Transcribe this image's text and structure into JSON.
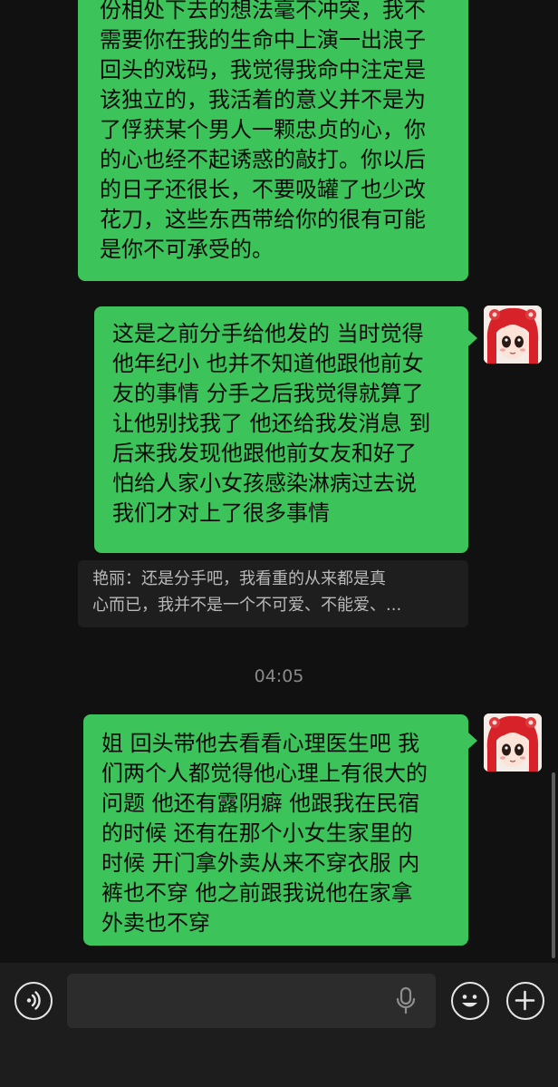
{
  "messages": [
    {
      "lines": [
        "份相处下去的想法毫不冲突，我不",
        "需要你在我的生命中上演一出浪子",
        "回头的戏码，我觉得我命中注定是",
        "该独立的，我活着的意义并不是为",
        "了俘获某个男人一颗忠贞的心，你",
        "的心也经不起诱惑的敲打。你以后",
        "的日子还很长，不要吸罐了也少改",
        "花刀，这些东西带给你的很有可能",
        "是你不可承受的。"
      ]
    },
    {
      "lines": [
        "这是之前分手给他发的 当时觉得",
        "他年纪小 也并不知道他跟他前女",
        "友的事情 分手之后我觉得就算了",
        "让他别找我了 他还给我发消息 到",
        "后来我发现他跟他前女友和好了",
        "怕给人家小女孩感染淋病过去说",
        "我们才对上了很多事情"
      ]
    },
    {
      "lines": [
        "姐 回头带他去看看心理医生吧 我",
        "们两个人都觉得他心理上有很大的",
        "问题 他还有露阴癖 他跟我在民宿",
        "的时候 还有在那个小女生家里的",
        "时候 开门拿外卖从来不穿衣服 内",
        "裤也不穿 他之前跟我说他在家拿",
        "外卖也不穿"
      ]
    }
  ],
  "quote": {
    "line1": "艳丽：还是分手吧，我看重的从来都是真",
    "line2": "心而已，我并不是一个不可爱、不能爱、..."
  },
  "timestamp": "04:05",
  "input": {
    "value": "",
    "placeholder": ""
  },
  "icons": {
    "voice": "voice-mode-icon",
    "mic": "microphone-icon",
    "emoji": "emoji-icon",
    "plus": "plus-icon"
  },
  "colors": {
    "background": "#111111",
    "sent_bubble": "#3cc45b",
    "input_bar": "#1d1d1d",
    "quote_bg": "#1e1e1e"
  }
}
